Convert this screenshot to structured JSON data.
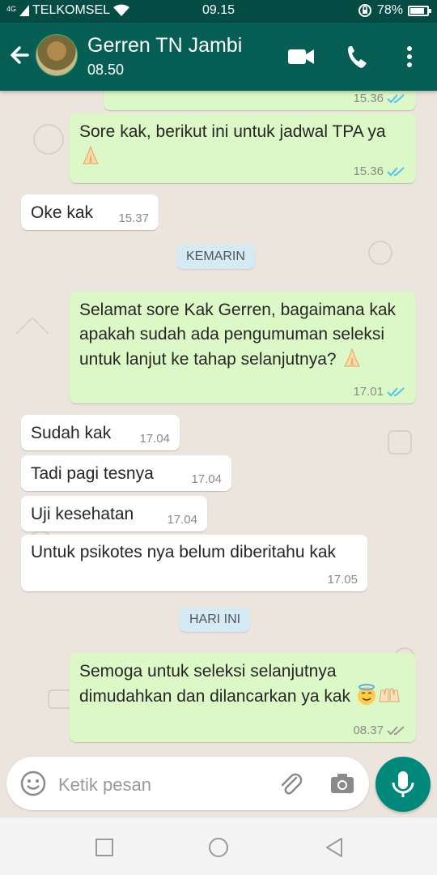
{
  "status_bar": {
    "network_type": "4G",
    "carrier": "TELKOMSEL",
    "time": "09.15",
    "battery_text": "78%",
    "battery_level": 0.78
  },
  "header": {
    "contact_name": "Gerren TN Jambi",
    "contact_status": "08.50",
    "icons": [
      "back-arrow-icon",
      "avatar",
      "video-call-icon",
      "voice-call-icon",
      "more-options-icon"
    ]
  },
  "messages": [
    {
      "dir": "out",
      "text": "",
      "time": "15.36",
      "ticks": "read"
    },
    {
      "dir": "out",
      "text": "Sore kak,  berikut ini untuk jadwal TPA ya",
      "emoji": "praying-hands",
      "time": "15.36",
      "ticks": "read"
    },
    {
      "dir": "in",
      "text": "Oke kak",
      "time": "15.37"
    },
    {
      "dir": "out",
      "text": "Selamat sore Kak Gerren, bagaimana kak apakah sudah ada pengumuman seleksi untuk lanjut ke tahap selanjutnya?",
      "emoji": "praying-hands",
      "time": "17.01",
      "ticks": "read"
    },
    {
      "dir": "in",
      "text": "Sudah kak",
      "time": "17.04"
    },
    {
      "dir": "in",
      "text": "Tadi pagi tesnya",
      "time": "17.04"
    },
    {
      "dir": "in",
      "text": "Uji kesehatan",
      "time": "17.04"
    },
    {
      "dir": "in",
      "text": "Untuk psikotes nya belum diberitahu kak",
      "time": "17.05"
    },
    {
      "dir": "out",
      "text": "Semoga untuk seleksi selanjutnya dimudahkan dan dilancarkan ya kak",
      "emoji": "smiling-halo, open-hands",
      "time": "08.37",
      "ticks": "delivered"
    }
  ],
  "dividers": {
    "yesterday": "KEMARIN",
    "today": "HARI INI"
  },
  "composer": {
    "placeholder": "Ketik pesan",
    "icons": [
      "emoji-icon",
      "attach-icon",
      "camera-icon",
      "mic-icon"
    ]
  },
  "colors": {
    "header": "#075e54",
    "status_bar": "#054d44",
    "outgoing_bubble": "#dcf8c6",
    "incoming_bubble": "#ffffff",
    "chat_background": "#ece5dd",
    "read_tick": "#4fc3f7",
    "accent": "#00897b"
  }
}
